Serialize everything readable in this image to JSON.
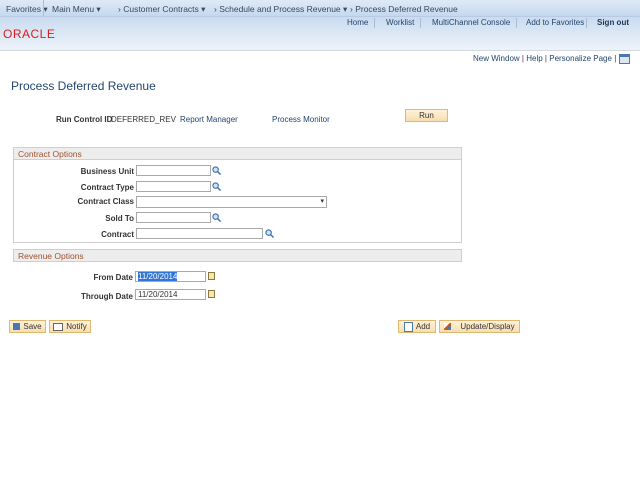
{
  "nav": {
    "favorites": "Favorites",
    "main_menu": "Main Menu",
    "crumbs": [
      "Customer Contracts",
      "Schedule and Process Revenue",
      "Process Deferred Revenue"
    ]
  },
  "header": {
    "logo": "ORACLE",
    "links": [
      "Home",
      "Worklist",
      "MultiChannel Console",
      "Add to Favorites"
    ],
    "sign_out": "Sign out"
  },
  "toolbar": {
    "new_window": "New Window",
    "help": "Help",
    "personalize": "Personalize Page"
  },
  "page": {
    "title": "Process Deferred Revenue"
  },
  "run_control": {
    "label": "Run Control ID",
    "value": "DEFERRED_REV",
    "report_manager": "Report Manager",
    "process_monitor": "Process Monitor",
    "run": "Run"
  },
  "contract_options": {
    "title": "Contract Options",
    "business_unit": "Business Unit",
    "contract_type": "Contract Type",
    "contract_class": "Contract Class",
    "sold_to": "Sold To",
    "contract": "Contract"
  },
  "revenue_options": {
    "title": "Revenue Options",
    "from_date_label": "From Date",
    "from_date": "11/20/2014",
    "through_date_label": "Through Date",
    "through_date": "11/20/2014"
  },
  "buttons": {
    "save": "Save",
    "notify": "Notify",
    "add": "Add",
    "update_display": "Update/Display"
  },
  "colors": {
    "accent_link": "#24466f",
    "logo": "#e01b1b",
    "group_title": "#a0522d",
    "button_border": "#e0b870"
  }
}
